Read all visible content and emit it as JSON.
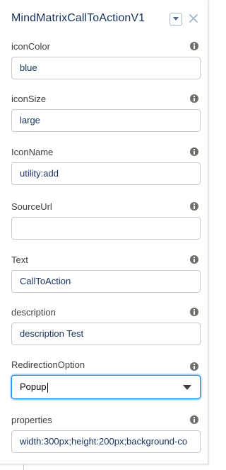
{
  "header": {
    "title": "MindMatrixCallToActionV1",
    "dropdown_icon": "chevron-down-icon",
    "close_icon": "close-icon"
  },
  "fields": [
    {
      "label": "iconColor",
      "value": "blue",
      "type": "text"
    },
    {
      "label": "iconSize",
      "value": "large",
      "type": "text"
    },
    {
      "label": "IconName",
      "value": "utility:add",
      "type": "text"
    },
    {
      "label": "SourceUrl",
      "value": "",
      "type": "text"
    },
    {
      "label": "Text",
      "value": "CallToAction",
      "type": "text"
    },
    {
      "label": "description",
      "value": "description Test",
      "type": "text"
    },
    {
      "label": "RedirectionOption",
      "value": "Popup",
      "type": "select"
    },
    {
      "label": "properties",
      "value": "width:300px;height:200px;background-co",
      "type": "text"
    }
  ],
  "colors": {
    "title": "#16325c",
    "input_text": "#16325c",
    "focus_border": "#1589ee",
    "info_icon": "#706e6b"
  }
}
